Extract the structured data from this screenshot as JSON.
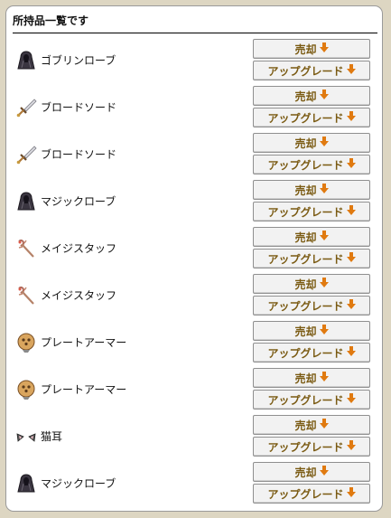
{
  "panel": {
    "title": "所持品一覧です"
  },
  "buttons": {
    "sell": "売却",
    "upgrade": "アップグレード"
  },
  "items": [
    {
      "name": "ゴブリンローブ",
      "icon": "robe-icon",
      "tint": "#5a5560"
    },
    {
      "name": "ブロードソード",
      "icon": "sword-icon",
      "tint": "#9d9da3"
    },
    {
      "name": "ブロードソード",
      "icon": "sword-icon",
      "tint": "#9d9da3"
    },
    {
      "name": "マジックローブ",
      "icon": "robe-icon",
      "tint": "#3e3846"
    },
    {
      "name": "メイジスタッフ",
      "icon": "staff-icon",
      "tint": "#b58268"
    },
    {
      "name": "メイジスタッフ",
      "icon": "staff-icon",
      "tint": "#b58268"
    },
    {
      "name": "プレートアーマー",
      "icon": "armor-icon",
      "tint": "#d39a55"
    },
    {
      "name": "プレートアーマー",
      "icon": "armor-icon",
      "tint": "#d39a55"
    },
    {
      "name": "猫耳",
      "icon": "cat-ears-icon",
      "tint": "#555555"
    },
    {
      "name": "マジックローブ",
      "icon": "robe-icon",
      "tint": "#3e3846"
    }
  ],
  "colors": {
    "arrow": "#e07a10",
    "button_text": "#7a5a12"
  }
}
